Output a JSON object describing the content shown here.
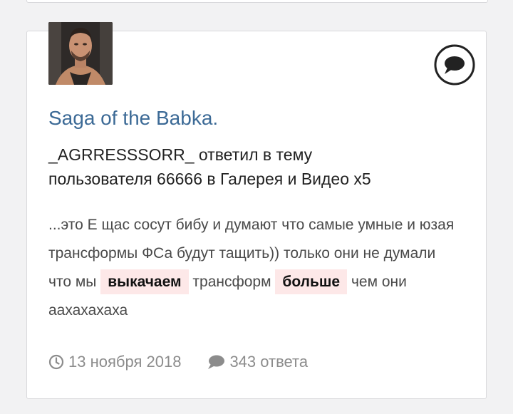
{
  "post": {
    "title": "Saga of the Babka.",
    "activity_line1": "_AGRRESSSORR_ ответил в тему",
    "activity_line2": "пользователя 66666 в Галерея и Видео x5",
    "snippet": {
      "part1": "...это Е щас сосут бибу и думают что самые умные и юзая трансформы ФСа будут тащить)) только они не думали что мы",
      "highlight1": "выкачаем",
      "part2": "трансформ",
      "highlight2": "больше",
      "part3": "чем они аахахахаха"
    },
    "date": "13 ноября 2018",
    "replies": "343 ответа"
  },
  "icons": {
    "top_right": "speech-bubble-icon",
    "date": "clock-icon",
    "replies": "comment-icon"
  },
  "colors": {
    "title": "#3c6a96",
    "highlight_bg": "#fde8e8",
    "meta": "#8c8c8c"
  }
}
